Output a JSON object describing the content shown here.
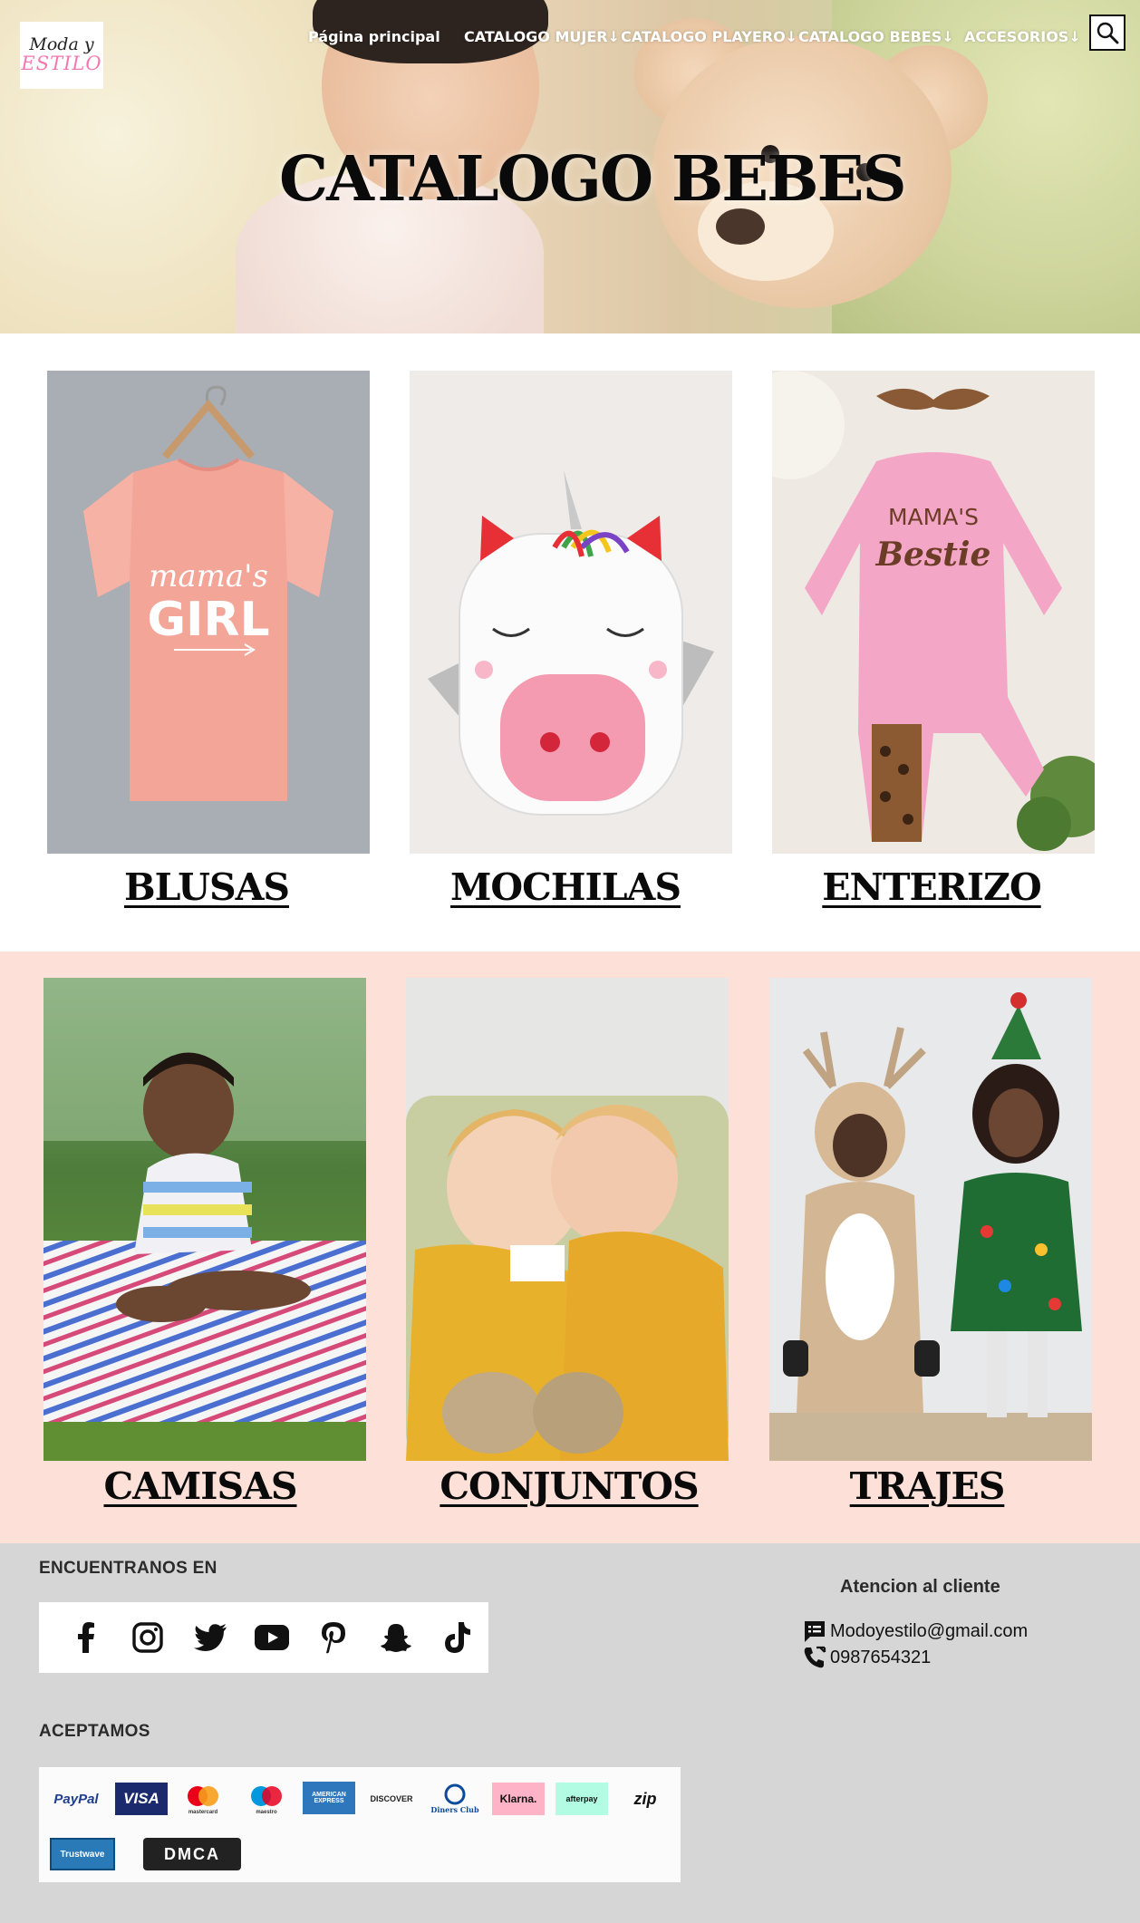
{
  "header": {
    "logo_line1": "Moda y",
    "logo_line2": "ESTILO",
    "nav": [
      {
        "label": "Página principal"
      },
      {
        "label": "CATALOGO MUJER↓"
      },
      {
        "label": "CATALOGO PLAYERO↓"
      },
      {
        "label": "CATALOGO BEBES↓"
      },
      {
        "label": "ACCESORIOS↓"
      }
    ],
    "search_icon": "search-icon"
  },
  "hero": {
    "title": "CATALOGO BEBES"
  },
  "categories": [
    {
      "label": "BLUSAS",
      "image": "pink-tshirt-mamas-girl",
      "shirt_text_1": "mama's",
      "shirt_text_2": "GIRL"
    },
    {
      "label": "MOCHILAS",
      "image": "unicorn-backpack"
    },
    {
      "label": "ENTERIZO",
      "image": "pink-romper-mamas-bestie",
      "shirt_text_1": "MAMA'S",
      "shirt_text_2": "Bestie"
    },
    {
      "label": "CAMISAS",
      "image": "baby-on-striped-blanket"
    },
    {
      "label": "CONJUNTOS",
      "image": "toddlers-hugging"
    },
    {
      "label": "TRAJES",
      "image": "kids-in-costumes"
    }
  ],
  "footer": {
    "find_us": "ENCUENTRANOS EN",
    "social": [
      "facebook-icon",
      "instagram-icon",
      "twitter-icon",
      "youtube-icon",
      "pinterest-icon",
      "snapchat-icon",
      "tiktok-icon"
    ],
    "accept": "ACEPTAMOS",
    "payments": [
      "PayPal",
      "VISA",
      "mastercard",
      "maestro",
      "AMERICAN EXPRESS",
      "DISCOVER",
      "Diners Club",
      "Klarna.",
      "afterpay",
      "zip",
      "Trustwave",
      "DMCA"
    ],
    "customer_service_title": "Atencion al cliente",
    "email": "Modoyestilo@gmail.com",
    "phone": "0987654321"
  },
  "colors": {
    "row2_bg": "#fde1d8",
    "footer_bg": "#d6d6d6",
    "logo_pink": "#f07ab0"
  }
}
